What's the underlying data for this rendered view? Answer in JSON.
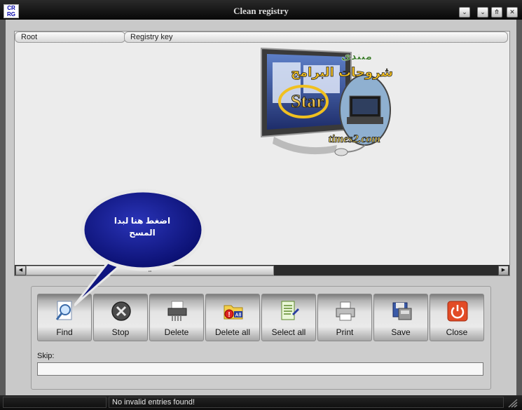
{
  "window": {
    "title": "Clean registry",
    "icon_text": [
      "CR",
      "RG"
    ],
    "buttons": {
      "minimize": "⌄",
      "restore": "⌄",
      "maximize": "⤊",
      "close": "✕"
    }
  },
  "list": {
    "columns": [
      "Root",
      "Registry key"
    ],
    "logo_text": {
      "line1": "منتدى",
      "line2": "شروحات البرامج",
      "brand": "Star",
      "site": "times2.com"
    },
    "scroll_label": "ff"
  },
  "callout": {
    "text": "اضغط هنا لبدا المسح"
  },
  "toolbar": {
    "buttons": [
      {
        "label": "Find",
        "icon": "magnifier-icon"
      },
      {
        "label": "Stop",
        "icon": "stop-icon"
      },
      {
        "label": "Delete",
        "icon": "shredder-icon"
      },
      {
        "label": "Delete all",
        "icon": "folder-delete-all-icon"
      },
      {
        "label": "Select all",
        "icon": "document-select-icon"
      },
      {
        "label": "Print",
        "icon": "printer-icon"
      },
      {
        "label": "Save",
        "icon": "save-disk-icon"
      },
      {
        "label": "Close",
        "icon": "power-icon"
      }
    ]
  },
  "skip": {
    "label": "Skip:",
    "value": ""
  },
  "status": {
    "message": "No invalid entries found!"
  },
  "colors": {
    "close_red": "#e24b26",
    "balloon_blue": "#12188f",
    "title_text": "#dadada"
  }
}
